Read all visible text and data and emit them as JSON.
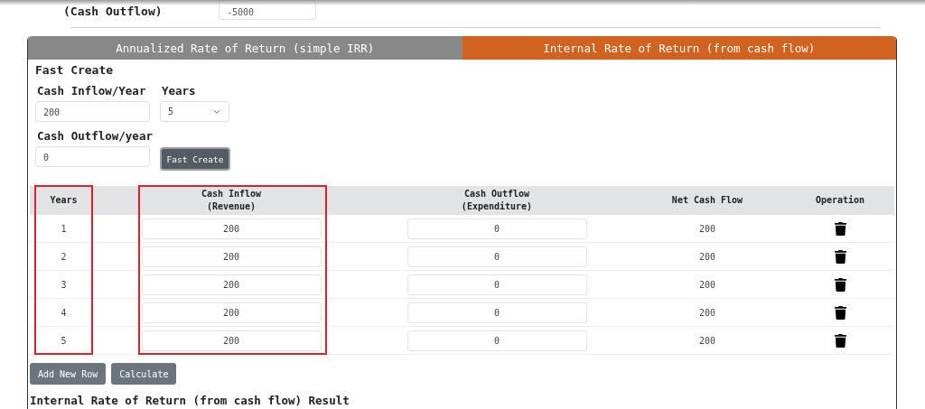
{
  "initial_capital": {
    "label": "(Cash Outflow)",
    "value": "-5000"
  },
  "tabs": [
    {
      "label": "Annualized Rate of Return (simple IRR)",
      "selected": false
    },
    {
      "label": "Internal Rate of Return (from cash flow)",
      "selected": true
    }
  ],
  "fast_create": {
    "title": "Fast Create",
    "inflow": {
      "label": "Cash Inflow/Year",
      "value": "200"
    },
    "years": {
      "label": "Years",
      "value": "5"
    },
    "outflow": {
      "label": "Cash Outflow/year",
      "value": "0"
    },
    "button": "Fast Create"
  },
  "table": {
    "columns": [
      {
        "label": "Years",
        "highlighted": true
      },
      {
        "label": "Cash Inflow",
        "sublabel": "(Revenue)",
        "highlighted": true
      },
      {
        "label": "Cash Outflow",
        "sublabel": "(Expenditure)",
        "highlighted": false
      },
      {
        "label": "Net Cash Flow",
        "highlighted": false
      },
      {
        "label": "Operation",
        "highlighted": false
      }
    ],
    "rows": [
      {
        "year": "1",
        "inflow": "200",
        "outflow": "0",
        "net": "200"
      },
      {
        "year": "2",
        "inflow": "200",
        "outflow": "0",
        "net": "200"
      },
      {
        "year": "3",
        "inflow": "200",
        "outflow": "0",
        "net": "200"
      },
      {
        "year": "4",
        "inflow": "200",
        "outflow": "0",
        "net": "200"
      },
      {
        "year": "5",
        "inflow": "200",
        "outflow": "0",
        "net": "200"
      }
    ]
  },
  "buttons": [
    "Add New Row",
    "Calculate"
  ],
  "result_title": "Internal Rate of Return (from cash flow) Result"
}
